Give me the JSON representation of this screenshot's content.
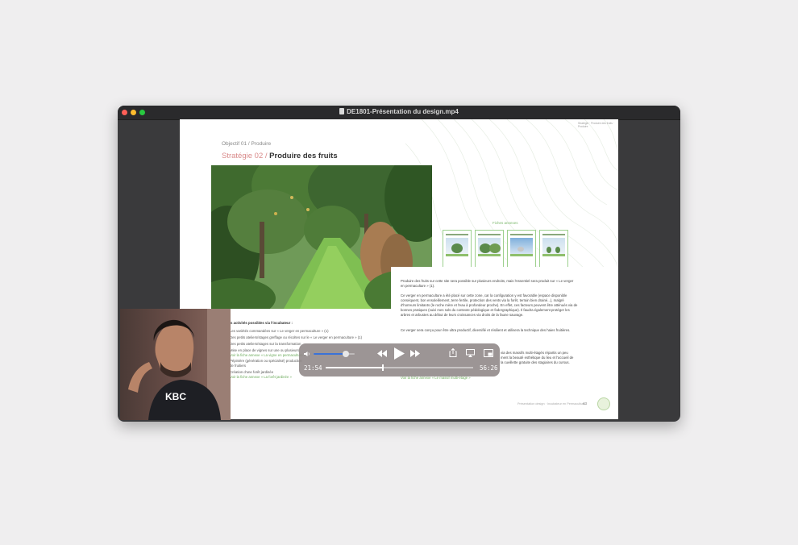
{
  "window": {
    "title": "DE1801-Présentation du design.mp4"
  },
  "slide": {
    "header_right": "Stratégie · Produire des fruits · Produire",
    "breadcrumb": "Objectif 01 / Produire",
    "strategy_label": "Stratégie 02 /",
    "strategy_title": "Produire des fruits",
    "fiches_label": "Fiches annexes",
    "thumbnails": [
      {
        "title": "Le verger en permaculture"
      },
      {
        "title": "Le massif multi-étagé"
      },
      {
        "title": "La forêt jardin"
      },
      {
        "title": "Le verger en permaculture"
      }
    ],
    "paragraphs": [
      "Produire des fruits sur cette site sera possible sur plusieurs endroits, mais l'essentiel sera produit sur « Le verger en permaculture » (1).",
      "Ce verger en permaculture a été placé sur cette zone, car la configuration y est favorable (espace disponible conséquent, bon ensoleillement, terre fertile, protection des vents via la forêt, terrain bien drainé...), malgré d'horreurs limitants (le roche mère et l'eau à profondeur proche). En effet, ces facteurs peuvent être atténués via de bonnes pratiques (suivi mes sols du contexte pédologique et fodergraphique). Il faudra également protéger les arbres et arbustes au début de leurs croissances via droits de la faune sauvage.",
      "Ce verger sera conçu pour être ultra productif, diversifié et résilient et utilisera la technique des haies fruitières."
    ],
    "para4_lines": [
      "via des massifs multi-étagés répartis un peu",
      "ment la beauté esthétique du lieu et l'accueil de",
      "la cueillette gratuite des stagiaires du cursus."
    ],
    "link_massif": "Voir la fiche annexe « Le massif multi-étagé »",
    "activities_title": "Les activités possibles via l'incubateur :",
    "activities": [
      "Les variétés commandées sur « Le verger en permaculture » (1)",
      "Des petits ateliers/stages greffage ou récoltes sur le « Le verger en permaculture » (1)",
      "Des petits ateliers/stages sur la transformation",
      "Mise en place de vignes sur une ou plusieurs",
      "Voir la fiche annexe « La vigne en permaculture »",
      "Pépinière (génération ou spécialisé) production",
      "de fruitiers",
      "Création d'une forêt jardinée",
      "Voir la fiche annexe « La forêt jardinée »"
    ],
    "footer": "Présentation design · Incubateur en Permaculture",
    "page_number": "43"
  },
  "player": {
    "current_time": "21:54",
    "total_time": "56:26",
    "progress": 0.388,
    "volume": 0.78
  },
  "webcam": {
    "shirt_text": "KBC"
  },
  "colors": {
    "accent_green": "#7cb86c",
    "strategy_pink": "#d98a8a",
    "volume_blue": "#3a72d8",
    "desktop": "#efeeef"
  }
}
